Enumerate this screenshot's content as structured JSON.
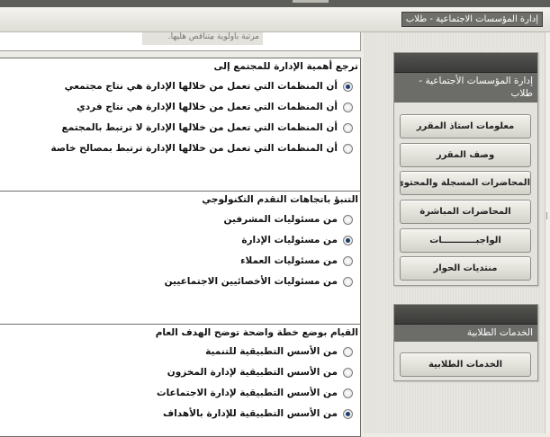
{
  "breadcrumb": "إدارة المؤسسات الاجتماعية - طلاب",
  "top_fragment": "مرتبة بأولوية متناقص هليها.",
  "questions": [
    {
      "title": "ترجع أهمية الإدارة للمجتمع إلى",
      "options": [
        {
          "label": "أن المنظمات التي تعمل من خلالها الإدارة هي نتاج مجتمعي",
          "selected": true
        },
        {
          "label": "أن المنظمات التي تعمل من خلالها الإدارة هي نتاج فردي",
          "selected": false
        },
        {
          "label": "أن المنظمات التي تعمل من خلالها الإدارة لا ترتبط بالمجتمع",
          "selected": false
        },
        {
          "label": "أن المنظمات التي تعمل من خلالها الإدارة ترتبط بمصالح خاصة",
          "selected": false
        }
      ]
    },
    {
      "title": "التنبؤ باتجاهات التقدم التكنولوجي",
      "options": [
        {
          "label": "من مسئوليات المشرفين",
          "selected": false
        },
        {
          "label": "من مسئوليات الإدارة",
          "selected": true
        },
        {
          "label": "من مسئوليات العملاء",
          "selected": false
        },
        {
          "label": "من مسئوليات الأخصائيين الاجتماعيين",
          "selected": false
        }
      ]
    },
    {
      "title": "القيام بوضع خطة واضحة توضح الهدف العام",
      "options": [
        {
          "label": "من الأسس التطبيقية للتنمية",
          "selected": false
        },
        {
          "label": "من الأسس التطبيقية لإدارة المخزون",
          "selected": false
        },
        {
          "label": "من الأسس التطبيقية لإدارة الاجتماعات",
          "selected": false
        },
        {
          "label": "من الأسس التطبيقية للإدارة بالأهداف",
          "selected": true
        }
      ]
    }
  ],
  "sidebar": {
    "course_panel": {
      "title": "إدارة المؤسسات الأجتماعية - طلاب",
      "buttons": [
        "معلومات استاذ المقرر",
        "وصف المقرر",
        "المحاضرات المسجلة والمحتوى",
        "المحاضرات المباشرة",
        "الواجبـــــــــــات",
        "منتديات الحوار"
      ]
    },
    "services_panel": {
      "title": "الخدمات الطلابية",
      "buttons": [
        "الخدمات الطلابية"
      ]
    }
  },
  "colors": {
    "panel_header": "#3b3b39",
    "panel_title": "#6c6c68",
    "radio_selected": "#1c3d6e"
  }
}
